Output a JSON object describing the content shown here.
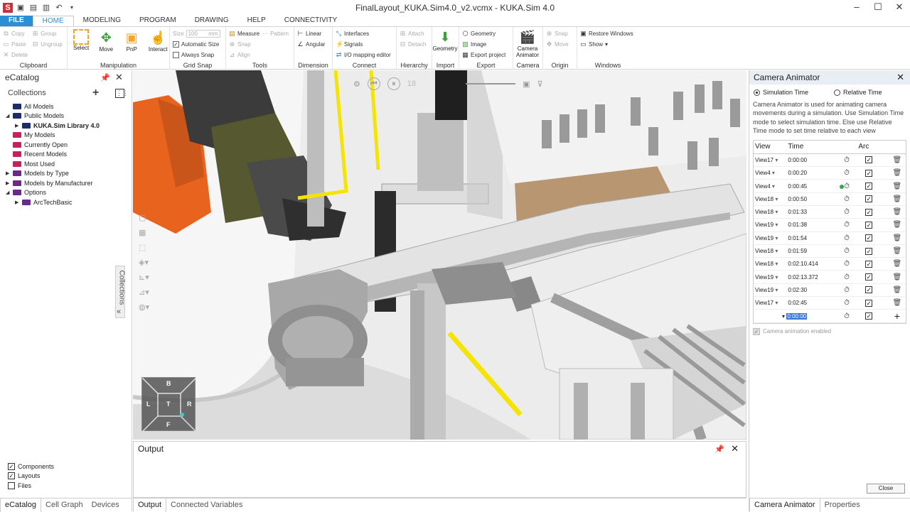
{
  "window": {
    "title": "FinalLayout_KUKA.Sim4.0_v2.vcmx - KUKA.Sim 4.0"
  },
  "ribbon_tabs": [
    {
      "label": "FILE"
    },
    {
      "label": "HOME"
    },
    {
      "label": "MODELING"
    },
    {
      "label": "PROGRAM"
    },
    {
      "label": "DRAWING"
    },
    {
      "label": "HELP"
    },
    {
      "label": "CONNECTIVITY"
    }
  ],
  "ribbon": {
    "clipboard": {
      "label": "Clipboard",
      "copy": "Copy",
      "paste": "Paste",
      "delete": "Delete",
      "group": "Group",
      "ungroup": "Ungroup"
    },
    "manipulation": {
      "label": "Manipulation",
      "select": "Select",
      "move": "Move",
      "pnp": "PnP",
      "interact": "Interact"
    },
    "grid_snap": {
      "label": "Grid Snap",
      "size": "Size",
      "size_value": "100",
      "size_unit": "mm",
      "automatic_size": "Automatic Size",
      "always_snap": "Always Snap"
    },
    "tools": {
      "label": "Tools",
      "measure": "Measure",
      "pattern": "Pattern",
      "snap": "Snap",
      "align": "Align"
    },
    "dimension": {
      "label": "Dimension",
      "linear": "Linear",
      "angular": "Angular"
    },
    "connect": {
      "label": "Connect",
      "interfaces": "Interfaces",
      "signals": "Signals",
      "io_editor": "I/O mapping editor"
    },
    "hierarchy": {
      "label": "Hierarchy",
      "attach": "Attach",
      "detach": "Detach"
    },
    "import": {
      "label": "Import",
      "geometry": "Geometry"
    },
    "export": {
      "label": "Export",
      "geometry": "Geometry",
      "image": "Image",
      "export_project": "Export project"
    },
    "camera": {
      "label": "Camera",
      "camera_animator_line1": "Camera",
      "camera_animator_line2": "Animator"
    },
    "origin": {
      "label": "Origin",
      "snap": "Snap",
      "move": "Move"
    },
    "windows": {
      "label": "Windows",
      "restore": "Restore Windows",
      "show": "Show"
    }
  },
  "ecatalog": {
    "title": "eCatalog",
    "collections_label": "Collections",
    "tree": [
      {
        "label": "All Models",
        "indent": 1,
        "expander": "",
        "color": "#1d2d6b"
      },
      {
        "label": "Public Models",
        "indent": 1,
        "expander": "◢",
        "color": "#1d2d6b"
      },
      {
        "label": "KUKA.Sim Library 4.0",
        "indent": 2,
        "expander": "▶",
        "color": "#1d2d6b",
        "bold": true
      },
      {
        "label": "My Models",
        "indent": 1,
        "expander": "",
        "color": "#c1245c"
      },
      {
        "label": "Currently Open",
        "indent": 1,
        "expander": "",
        "color": "#c1245c"
      },
      {
        "label": "Recent Models",
        "indent": 1,
        "expander": "",
        "color": "#c1245c"
      },
      {
        "label": "Most Used",
        "indent": 1,
        "expander": "",
        "color": "#c1245c"
      },
      {
        "label": "Models by Type",
        "indent": 1,
        "expander": "▶",
        "color": "#6a2a8c"
      },
      {
        "label": "Models by Manufacturer",
        "indent": 1,
        "expander": "▶",
        "color": "#6a2a8c"
      },
      {
        "label": "Options",
        "indent": 1,
        "expander": "◢",
        "color": "#6a2a8c"
      },
      {
        "label": "ArcTechBasic",
        "indent": 2,
        "expander": "▶",
        "color": "#6a2a8c"
      }
    ],
    "side_tab": "Collections",
    "filters": [
      {
        "label": "Components",
        "checked": true
      },
      {
        "label": "Layouts",
        "checked": true
      },
      {
        "label": "Files",
        "checked": false
      }
    ],
    "bottom_tabs": [
      "eCatalog",
      "Cell Graph",
      "Devices"
    ]
  },
  "viewport": {
    "navcube": {
      "top": "B",
      "left": "L",
      "center": "T",
      "right": "R",
      "bottom": "F"
    },
    "timer": "18"
  },
  "output": {
    "title": "Output",
    "tabs": [
      "Output",
      "Connected Variables"
    ]
  },
  "camera_animator": {
    "title": "Camera Animator",
    "simulation_time": "Simulation Time",
    "relative_time": "Relative Time",
    "description": "Camera Animator is used for animating camera movements during a simulation. Use Simulation Time mode to select simulation time. Else use Relative Time mode to set time relative to each view statements.",
    "columns": [
      "View",
      "Time",
      "Arc"
    ],
    "rows": [
      {
        "view": "View17",
        "time": "0:00:00",
        "active": false
      },
      {
        "view": "View4",
        "time": "0:00:20",
        "active": false
      },
      {
        "view": "View4",
        "time": "0:00:45",
        "active": true
      },
      {
        "view": "View18",
        "time": "0:00:50",
        "active": false
      },
      {
        "view": "View18",
        "time": "0:01:33",
        "active": false
      },
      {
        "view": "View19",
        "time": "0:01:38",
        "active": false
      },
      {
        "view": "View19",
        "time": "0:01:54",
        "active": false
      },
      {
        "view": "View18",
        "time": "0:01:59",
        "active": false
      },
      {
        "view": "View18",
        "time": "0:02:10.414",
        "active": false
      },
      {
        "view": "View19",
        "time": "0:02:13.372",
        "active": false
      },
      {
        "view": "View19",
        "time": "0:02:30",
        "active": false
      },
      {
        "view": "View17",
        "time": "0:02:45",
        "active": false
      }
    ],
    "new_row_time": "0:00:00",
    "enabled_label": "Camera animation enabled",
    "close_button": "Close",
    "bottom_tabs": [
      "Camera Animator",
      "Properties"
    ]
  },
  "colors": {
    "accent": "#2b8fd6",
    "robot_orange": "#e8641e",
    "guide_yellow": "#f5e400"
  }
}
